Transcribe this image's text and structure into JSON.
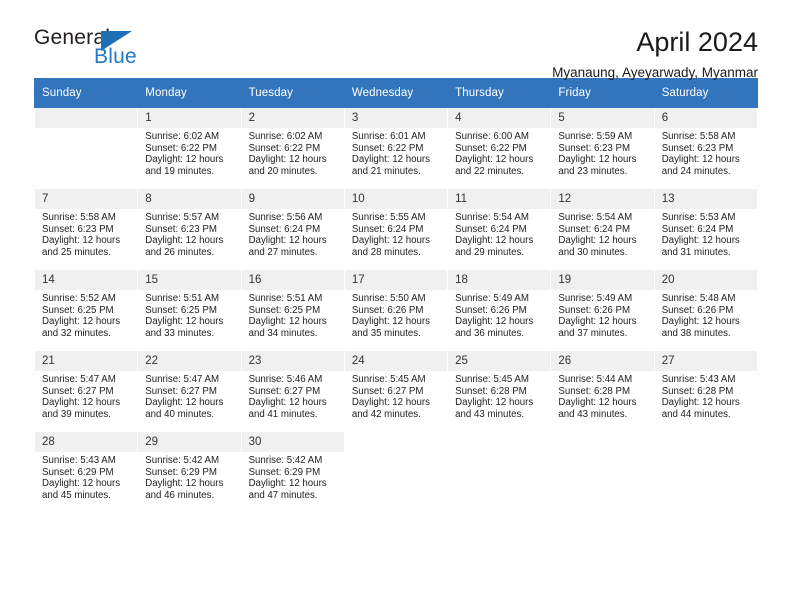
{
  "brand": {
    "word_one": "General",
    "word_two": "Blue",
    "icon": "triangle-logo-icon"
  },
  "header": {
    "title": "April 2024",
    "subtitle": "Myanaung, Ayeyarwady, Myanmar"
  },
  "calendar": {
    "accent_color": "#3275bd",
    "daynum_bg": "#f0f0f0",
    "weekday_headers": [
      "Sunday",
      "Monday",
      "Tuesday",
      "Wednesday",
      "Thursday",
      "Friday",
      "Saturday"
    ],
    "labels": {
      "sunrise": "Sunrise:",
      "sunset": "Sunset:",
      "daylight": "Daylight:"
    },
    "weeks": [
      [
        {
          "day": "",
          "blank": true
        },
        {
          "day": "1",
          "sunrise": "Sunrise: 6:02 AM",
          "sunset": "Sunset: 6:22 PM",
          "daylight_line1": "Daylight: 12 hours",
          "daylight_line2": "and 19 minutes."
        },
        {
          "day": "2",
          "sunrise": "Sunrise: 6:02 AM",
          "sunset": "Sunset: 6:22 PM",
          "daylight_line1": "Daylight: 12 hours",
          "daylight_line2": "and 20 minutes."
        },
        {
          "day": "3",
          "sunrise": "Sunrise: 6:01 AM",
          "sunset": "Sunset: 6:22 PM",
          "daylight_line1": "Daylight: 12 hours",
          "daylight_line2": "and 21 minutes."
        },
        {
          "day": "4",
          "sunrise": "Sunrise: 6:00 AM",
          "sunset": "Sunset: 6:22 PM",
          "daylight_line1": "Daylight: 12 hours",
          "daylight_line2": "and 22 minutes."
        },
        {
          "day": "5",
          "sunrise": "Sunrise: 5:59 AM",
          "sunset": "Sunset: 6:23 PM",
          "daylight_line1": "Daylight: 12 hours",
          "daylight_line2": "and 23 minutes."
        },
        {
          "day": "6",
          "sunrise": "Sunrise: 5:58 AM",
          "sunset": "Sunset: 6:23 PM",
          "daylight_line1": "Daylight: 12 hours",
          "daylight_line2": "and 24 minutes."
        }
      ],
      [
        {
          "day": "7",
          "sunrise": "Sunrise: 5:58 AM",
          "sunset": "Sunset: 6:23 PM",
          "daylight_line1": "Daylight: 12 hours",
          "daylight_line2": "and 25 minutes."
        },
        {
          "day": "8",
          "sunrise": "Sunrise: 5:57 AM",
          "sunset": "Sunset: 6:23 PM",
          "daylight_line1": "Daylight: 12 hours",
          "daylight_line2": "and 26 minutes."
        },
        {
          "day": "9",
          "sunrise": "Sunrise: 5:56 AM",
          "sunset": "Sunset: 6:24 PM",
          "daylight_line1": "Daylight: 12 hours",
          "daylight_line2": "and 27 minutes."
        },
        {
          "day": "10",
          "sunrise": "Sunrise: 5:55 AM",
          "sunset": "Sunset: 6:24 PM",
          "daylight_line1": "Daylight: 12 hours",
          "daylight_line2": "and 28 minutes."
        },
        {
          "day": "11",
          "sunrise": "Sunrise: 5:54 AM",
          "sunset": "Sunset: 6:24 PM",
          "daylight_line1": "Daylight: 12 hours",
          "daylight_line2": "and 29 minutes."
        },
        {
          "day": "12",
          "sunrise": "Sunrise: 5:54 AM",
          "sunset": "Sunset: 6:24 PM",
          "daylight_line1": "Daylight: 12 hours",
          "daylight_line2": "and 30 minutes."
        },
        {
          "day": "13",
          "sunrise": "Sunrise: 5:53 AM",
          "sunset": "Sunset: 6:24 PM",
          "daylight_line1": "Daylight: 12 hours",
          "daylight_line2": "and 31 minutes."
        }
      ],
      [
        {
          "day": "14",
          "sunrise": "Sunrise: 5:52 AM",
          "sunset": "Sunset: 6:25 PM",
          "daylight_line1": "Daylight: 12 hours",
          "daylight_line2": "and 32 minutes."
        },
        {
          "day": "15",
          "sunrise": "Sunrise: 5:51 AM",
          "sunset": "Sunset: 6:25 PM",
          "daylight_line1": "Daylight: 12 hours",
          "daylight_line2": "and 33 minutes."
        },
        {
          "day": "16",
          "sunrise": "Sunrise: 5:51 AM",
          "sunset": "Sunset: 6:25 PM",
          "daylight_line1": "Daylight: 12 hours",
          "daylight_line2": "and 34 minutes."
        },
        {
          "day": "17",
          "sunrise": "Sunrise: 5:50 AM",
          "sunset": "Sunset: 6:26 PM",
          "daylight_line1": "Daylight: 12 hours",
          "daylight_line2": "and 35 minutes."
        },
        {
          "day": "18",
          "sunrise": "Sunrise: 5:49 AM",
          "sunset": "Sunset: 6:26 PM",
          "daylight_line1": "Daylight: 12 hours",
          "daylight_line2": "and 36 minutes."
        },
        {
          "day": "19",
          "sunrise": "Sunrise: 5:49 AM",
          "sunset": "Sunset: 6:26 PM",
          "daylight_line1": "Daylight: 12 hours",
          "daylight_line2": "and 37 minutes."
        },
        {
          "day": "20",
          "sunrise": "Sunrise: 5:48 AM",
          "sunset": "Sunset: 6:26 PM",
          "daylight_line1": "Daylight: 12 hours",
          "daylight_line2": "and 38 minutes."
        }
      ],
      [
        {
          "day": "21",
          "sunrise": "Sunrise: 5:47 AM",
          "sunset": "Sunset: 6:27 PM",
          "daylight_line1": "Daylight: 12 hours",
          "daylight_line2": "and 39 minutes."
        },
        {
          "day": "22",
          "sunrise": "Sunrise: 5:47 AM",
          "sunset": "Sunset: 6:27 PM",
          "daylight_line1": "Daylight: 12 hours",
          "daylight_line2": "and 40 minutes."
        },
        {
          "day": "23",
          "sunrise": "Sunrise: 5:46 AM",
          "sunset": "Sunset: 6:27 PM",
          "daylight_line1": "Daylight: 12 hours",
          "daylight_line2": "and 41 minutes."
        },
        {
          "day": "24",
          "sunrise": "Sunrise: 5:45 AM",
          "sunset": "Sunset: 6:27 PM",
          "daylight_line1": "Daylight: 12 hours",
          "daylight_line2": "and 42 minutes."
        },
        {
          "day": "25",
          "sunrise": "Sunrise: 5:45 AM",
          "sunset": "Sunset: 6:28 PM",
          "daylight_line1": "Daylight: 12 hours",
          "daylight_line2": "and 43 minutes."
        },
        {
          "day": "26",
          "sunrise": "Sunrise: 5:44 AM",
          "sunset": "Sunset: 6:28 PM",
          "daylight_line1": "Daylight: 12 hours",
          "daylight_line2": "and 43 minutes."
        },
        {
          "day": "27",
          "sunrise": "Sunrise: 5:43 AM",
          "sunset": "Sunset: 6:28 PM",
          "daylight_line1": "Daylight: 12 hours",
          "daylight_line2": "and 44 minutes."
        }
      ],
      [
        {
          "day": "28",
          "sunrise": "Sunrise: 5:43 AM",
          "sunset": "Sunset: 6:29 PM",
          "daylight_line1": "Daylight: 12 hours",
          "daylight_line2": "and 45 minutes."
        },
        {
          "day": "29",
          "sunrise": "Sunrise: 5:42 AM",
          "sunset": "Sunset: 6:29 PM",
          "daylight_line1": "Daylight: 12 hours",
          "daylight_line2": "and 46 minutes."
        },
        {
          "day": "30",
          "sunrise": "Sunrise: 5:42 AM",
          "sunset": "Sunset: 6:29 PM",
          "daylight_line1": "Daylight: 12 hours",
          "daylight_line2": "and 47 minutes."
        },
        {
          "day": "",
          "empty": true
        },
        {
          "day": "",
          "empty": true
        },
        {
          "day": "",
          "empty": true
        },
        {
          "day": "",
          "empty": true
        }
      ]
    ]
  }
}
